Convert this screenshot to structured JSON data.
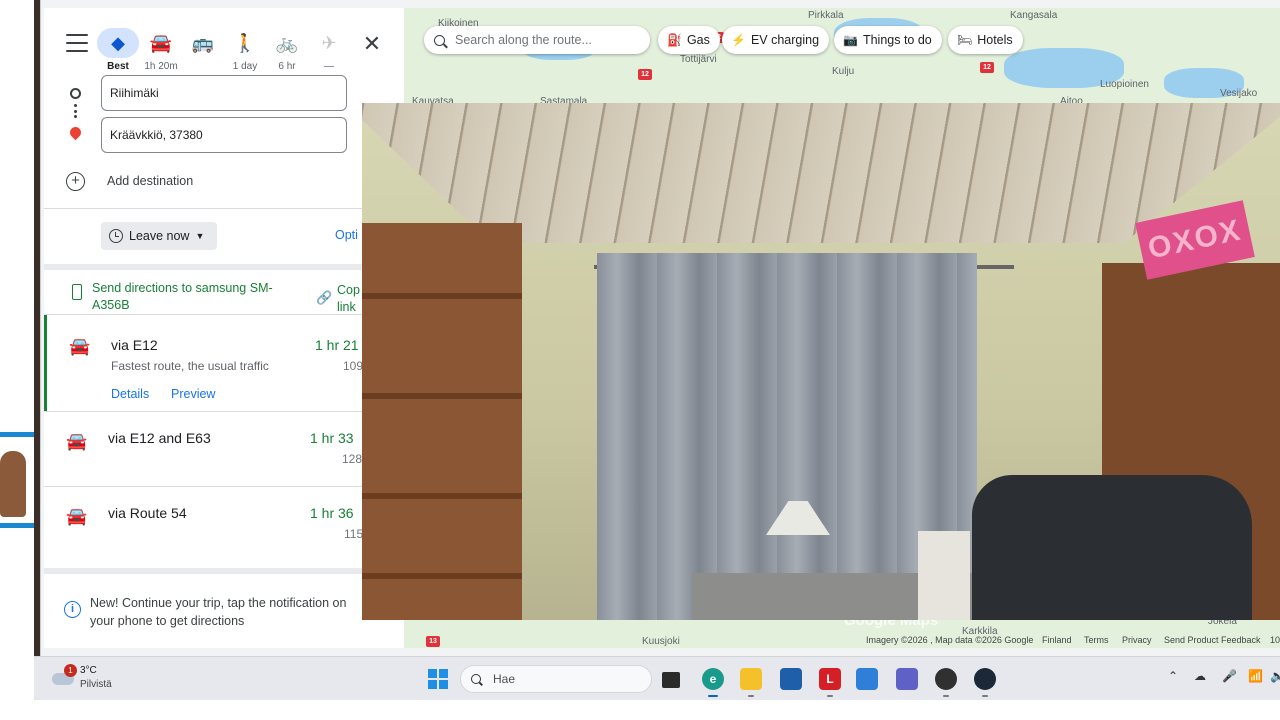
{
  "directions": {
    "modes": [
      {
        "name": "best",
        "icon": "directions-diamond-icon",
        "label": "Best"
      },
      {
        "name": "driving",
        "icon": "car-icon",
        "label": "1h 20m"
      },
      {
        "name": "transit",
        "icon": "bus-icon",
        "label": ""
      },
      {
        "name": "walking",
        "icon": "walk-icon",
        "label": "1 day"
      },
      {
        "name": "cycling",
        "icon": "bike-icon",
        "label": "6 hr"
      },
      {
        "name": "flights",
        "icon": "plane-icon",
        "label": "—"
      }
    ],
    "origin": "Riihimäki",
    "destination": "Kräävkkiö, 37380",
    "add_destination": "Add destination",
    "leave_now": "Leave now",
    "options_label": "Opti",
    "send_directions": "Send directions to samsung SM-A356B",
    "copy_link": "Cop\nlink",
    "routes": [
      {
        "via": "via E12",
        "sub": "Fastest route, the usual traffic",
        "time": "1 hr 21",
        "dist": "109",
        "details": "Details",
        "preview": "Preview"
      },
      {
        "via": "via E12 and E63",
        "sub": "",
        "time": "1 hr 33",
        "dist": "128"
      },
      {
        "via": "via Route 54",
        "sub": "",
        "time": "1 hr 36",
        "dist": "115"
      }
    ],
    "notice": "New! Continue your trip, tap the notification on your phone to get directions"
  },
  "map": {
    "search_placeholder": "Search along the route...",
    "chips": [
      {
        "icon": "gas-icon",
        "label": "Gas"
      },
      {
        "icon": "ev-charging-icon",
        "label": "EV charging"
      },
      {
        "icon": "camera-icon",
        "label": "Things to do"
      },
      {
        "icon": "bed-icon",
        "label": "Hotels"
      }
    ],
    "places": [
      "Kiikoinen",
      "Pirkkala",
      "Kangasala",
      "Tottijärvi",
      "Kulju",
      "Luopioinen",
      "Vesijako",
      "Kauvatsa",
      "Sastamala",
      "Aitoo",
      "Kuusjoki",
      "Karkkila",
      "Jokela"
    ],
    "road_numbers": [
      "12",
      "12",
      "12",
      "13"
    ],
    "logo": "Google Maps",
    "footer": {
      "imagery": "Imagery ©2026 , Map data ©2026 Google",
      "country": "Finland",
      "terms": "Terms",
      "privacy": "Privacy",
      "feedback": "Send Product Feedback",
      "scale": "10"
    }
  },
  "camera": {
    "sign_text": "OXOX"
  },
  "taskbar": {
    "weather_temp": "3°C",
    "weather_desc": "Pilvistä",
    "weather_badge": "1",
    "search_placeholder": "Hae",
    "apps": [
      {
        "name": "task-view",
        "letter": ""
      },
      {
        "name": "edge",
        "letter": "e"
      },
      {
        "name": "file-explorer",
        "letter": ""
      },
      {
        "name": "store",
        "letter": ""
      },
      {
        "name": "app-l",
        "letter": "L"
      },
      {
        "name": "outlook",
        "letter": ""
      },
      {
        "name": "teams",
        "letter": ""
      },
      {
        "name": "obs",
        "letter": ""
      },
      {
        "name": "steam",
        "letter": ""
      }
    ]
  },
  "colors": {
    "accent_green": "#188038",
    "link_blue": "#1a73e8",
    "selected_mode": "#d3e3fd"
  }
}
